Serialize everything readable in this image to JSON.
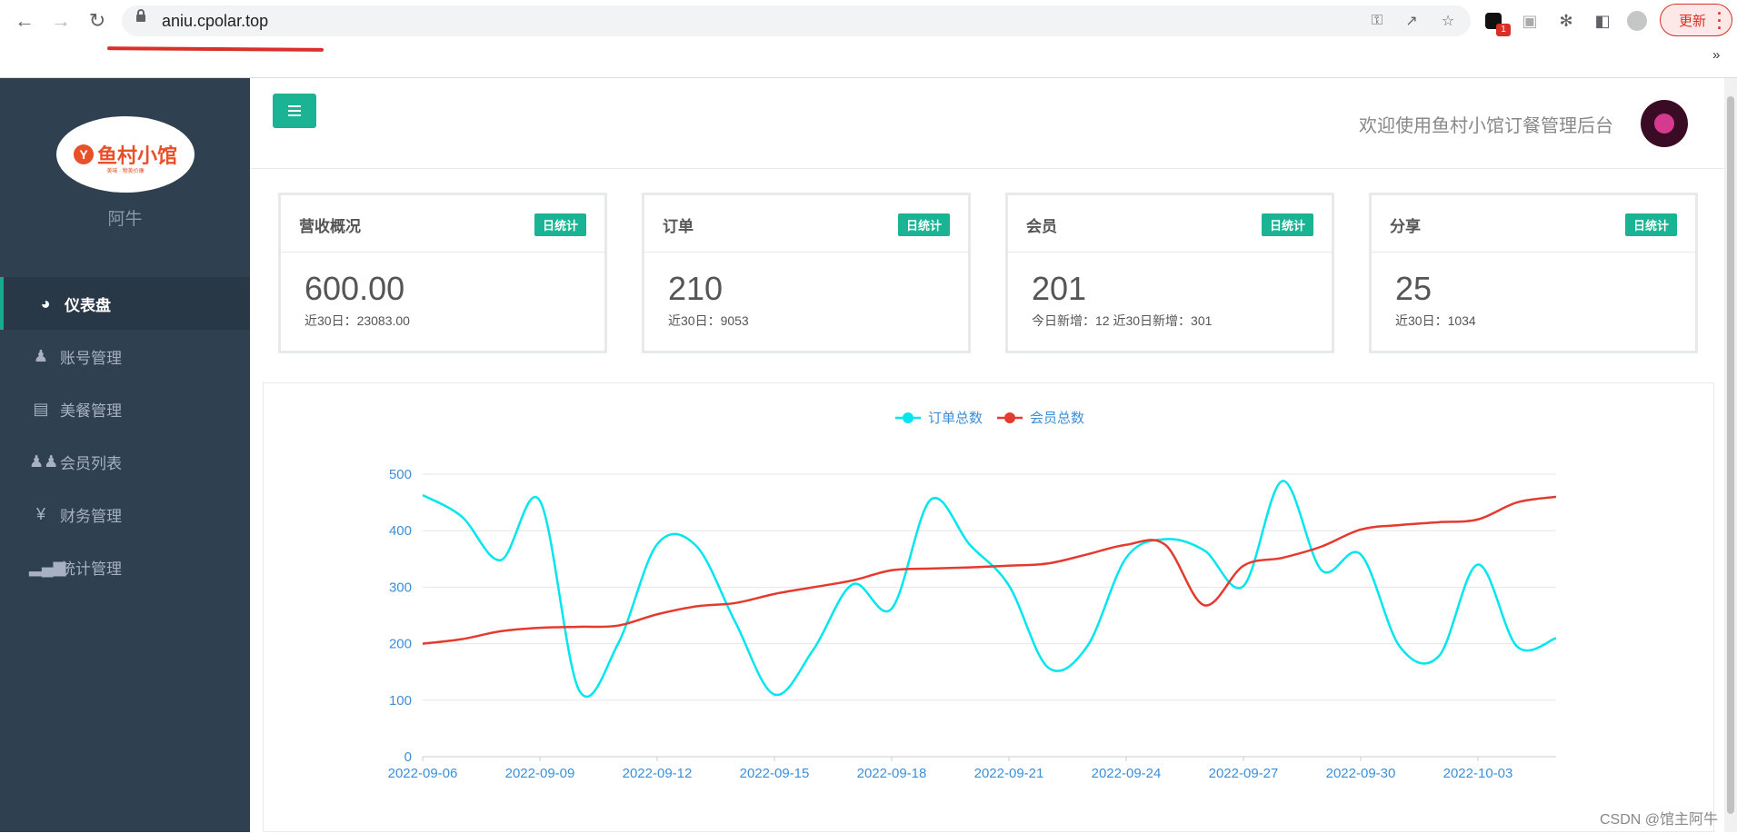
{
  "browser": {
    "url": "aniu.cpolar.top",
    "update_label": "更新",
    "more_label": "»",
    "ext_badge": "1"
  },
  "sidebar": {
    "logo_text": "鱼村小馆",
    "logo_sub": "美味 · 物美价廉",
    "username": "阿牛",
    "items": [
      {
        "label": "仪表盘",
        "icon": "dashboard-icon",
        "active": true
      },
      {
        "label": "账号管理",
        "icon": "user-icon",
        "active": false
      },
      {
        "label": "美餐管理",
        "icon": "book-icon",
        "active": false
      },
      {
        "label": "会员列表",
        "icon": "users-icon",
        "active": false
      },
      {
        "label": "财务管理",
        "icon": "yen-icon",
        "active": false
      },
      {
        "label": "统计管理",
        "icon": "bar-chart-icon",
        "active": false
      }
    ]
  },
  "header": {
    "welcome": "欢迎使用鱼村小馆订餐管理后台"
  },
  "cards": [
    {
      "title": "营收概况",
      "badge": "日统计",
      "value": "600.00",
      "sub": "近30日：23083.00"
    },
    {
      "title": "订单",
      "badge": "日统计",
      "value": "210",
      "sub": "近30日：9053"
    },
    {
      "title": "会员",
      "badge": "日统计",
      "value": "201",
      "sub": "今日新增：12 近30日新增：301"
    },
    {
      "title": "分享",
      "badge": "日统计",
      "value": "25",
      "sub": "近30日：1034"
    }
  ],
  "watermark": "CSDN @馆主阿牛",
  "chart_data": {
    "type": "line",
    "legend_position": "top-center",
    "ylim": [
      0,
      500
    ],
    "yticks": [
      0,
      100,
      200,
      300,
      400,
      500
    ],
    "x": [
      "2022-09-06",
      "2022-09-07",
      "2022-09-08",
      "2022-09-09",
      "2022-09-10",
      "2022-09-11",
      "2022-09-12",
      "2022-09-13",
      "2022-09-14",
      "2022-09-15",
      "2022-09-16",
      "2022-09-17",
      "2022-09-18",
      "2022-09-19",
      "2022-09-20",
      "2022-09-21",
      "2022-09-22",
      "2022-09-23",
      "2022-09-24",
      "2022-09-25",
      "2022-09-26",
      "2022-09-27",
      "2022-09-28",
      "2022-09-29",
      "2022-09-30",
      "2022-10-01",
      "2022-10-02",
      "2022-10-03",
      "2022-10-04",
      "2022-10-05"
    ],
    "xticks": [
      "2022-09-06",
      "2022-09-09",
      "2022-09-12",
      "2022-09-15",
      "2022-09-18",
      "2022-09-21",
      "2022-09-24",
      "2022-09-27",
      "2022-09-30",
      "2022-10-03"
    ],
    "series": [
      {
        "name": "订单总数",
        "color": "#00e5ee",
        "values": [
          463,
          425,
          348,
          453,
          118,
          200,
          376,
          373,
          238,
          110,
          190,
          305,
          262,
          455,
          375,
          303,
          158,
          195,
          352,
          385,
          365,
          302,
          488,
          330,
          358,
          195,
          178,
          340,
          195,
          210
        ]
      },
      {
        "name": "会员总数",
        "color": "#e43a2f",
        "values": [
          200,
          208,
          222,
          228,
          230,
          232,
          252,
          266,
          272,
          288,
          300,
          312,
          330,
          333,
          335,
          338,
          342,
          358,
          375,
          375,
          268,
          338,
          352,
          372,
          402,
          410,
          415,
          420,
          450,
          460
        ]
      }
    ]
  }
}
